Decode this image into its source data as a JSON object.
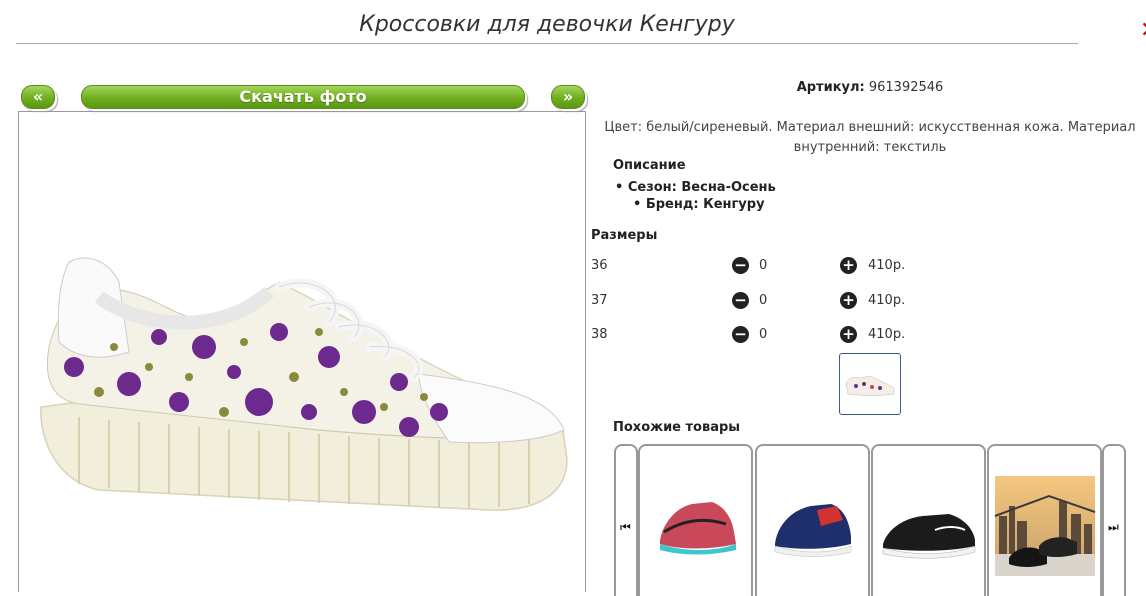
{
  "page": {
    "title": "Кроссовки для девочки Кенгуру"
  },
  "nav": {
    "prev_label": "«",
    "download_label": "Скачать фото",
    "next_label": "»"
  },
  "product": {
    "article_label": "Артикул:",
    "article_value": "961392546",
    "description_text": "Цвет: белый/сиреневый. Материал внешний: искусственная кожа. Материал внутренний: текстиль",
    "description_heading": "Описание",
    "bullets": [
      "Сезон: Весна-Осень",
      "Бренд: Кенгуру"
    ]
  },
  "sizes": {
    "heading": "Размеры",
    "rows": [
      {
        "size": "36",
        "qty": "0",
        "price": "410р."
      },
      {
        "size": "37",
        "qty": "0",
        "price": "410р."
      },
      {
        "size": "38",
        "qty": "0",
        "price": "410р."
      }
    ],
    "minus_icon": "minus-circle-icon",
    "plus_icon": "plus-circle-icon"
  },
  "similar": {
    "heading": "Похожие товары",
    "prev_icon": "skip-back-icon",
    "next_icon": "skip-forward-icon"
  },
  "colors": {
    "accent_green": "#6fae1f",
    "thumb_border": "#3b5a91",
    "corner_mark": "#cc0000"
  }
}
